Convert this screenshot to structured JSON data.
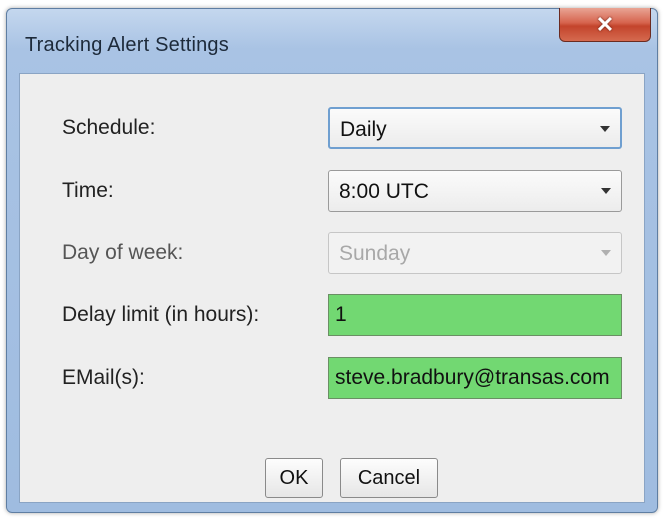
{
  "window": {
    "title": "Tracking Alert Settings",
    "close_glyph": "✕"
  },
  "form": {
    "schedule": {
      "label": "Schedule:",
      "value": "Daily"
    },
    "time": {
      "label": "Time:",
      "value": "8:00 UTC"
    },
    "day_of_week": {
      "label": "Day of week:",
      "value": "Sunday",
      "enabled": false
    },
    "delay_limit": {
      "label": "Delay limit (in hours):",
      "value": "1"
    },
    "emails": {
      "label": "EMail(s):",
      "value": "steve.bradbury@transas.com",
      "visible_text": "ve.bradbury@transas.com"
    }
  },
  "buttons": {
    "ok_label": "OK",
    "cancel_label": "Cancel"
  },
  "colors": {
    "valid_field": "#72d872",
    "title_bar": "#a9c3e4",
    "close_button": "#c3442c"
  },
  "icons": {
    "close": "close-icon",
    "dropdown": "chevron-down-icon"
  }
}
